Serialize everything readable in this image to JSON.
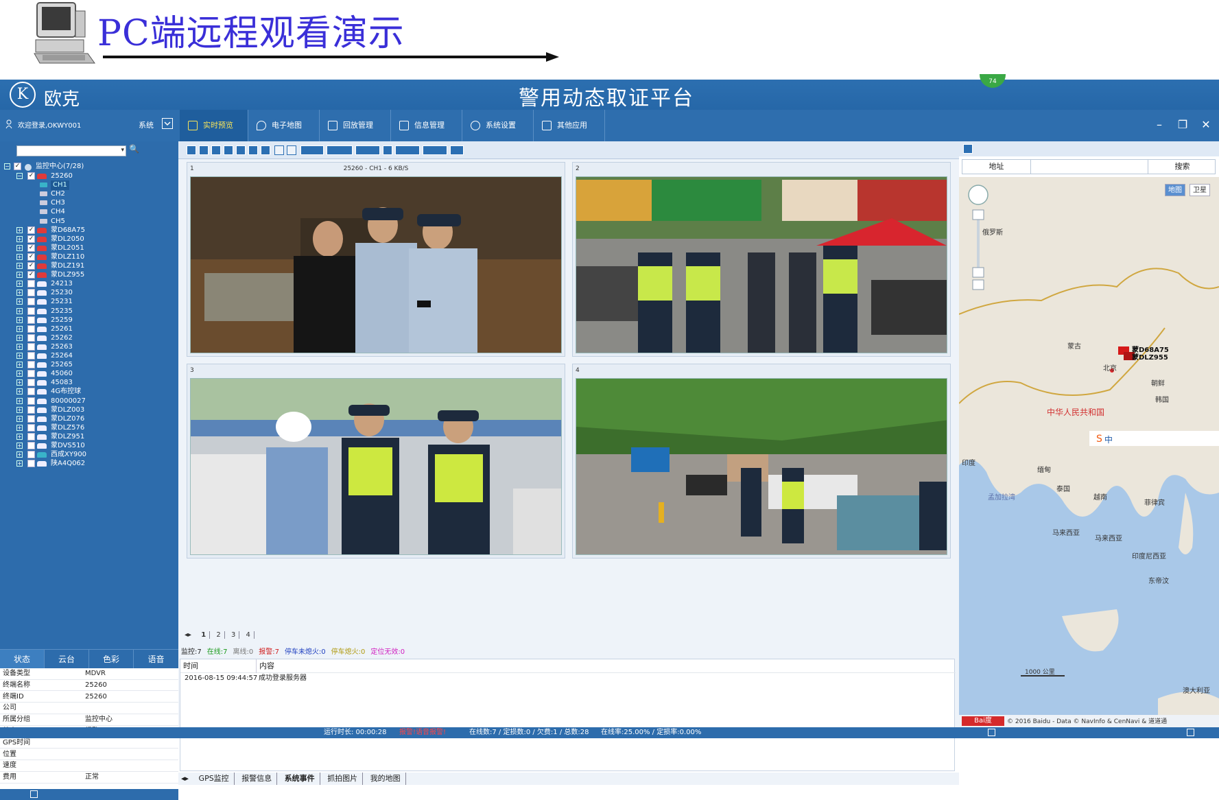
{
  "slide": {
    "title": "PC端远程观看演示"
  },
  "app": {
    "logo_text": "欧克",
    "logo_mark": "K",
    "platform_title": "警用动态取证平台",
    "badge": "74",
    "login_text": "欢迎登录,OKWY001",
    "system_label": "系统",
    "tabs": [
      {
        "label": "实时预览",
        "icon": "monitor-icon"
      },
      {
        "label": "电子地图",
        "icon": "map-pin-icon"
      },
      {
        "label": "回放管理",
        "icon": "video-camera-icon"
      },
      {
        "label": "信息管理",
        "icon": "document-icon"
      },
      {
        "label": "系统设置",
        "icon": "gear-icon"
      },
      {
        "label": "其他应用",
        "icon": "wrench-icon"
      }
    ],
    "window_buttons": {
      "minimize": "–",
      "restore": "❐",
      "close": "✕"
    }
  },
  "tree": {
    "root": "监控中心(7/28)",
    "nodes": [
      {
        "label": "25260",
        "checked": true,
        "alarm": true
      },
      {
        "label": "CH1",
        "channel": true,
        "selected": true
      },
      {
        "label": "CH2",
        "channel": true
      },
      {
        "label": "CH3",
        "channel": true
      },
      {
        "label": "CH4",
        "channel": true
      },
      {
        "label": "CH5",
        "channel": true
      },
      {
        "label": "蒙D68A75",
        "checked": true,
        "alarm": true
      },
      {
        "label": "蒙DL2050",
        "checked": true,
        "alarm": true
      },
      {
        "label": "蒙DL2051",
        "checked": true,
        "alarm": true
      },
      {
        "label": "蒙DLZ110",
        "checked": true,
        "alarm": true
      },
      {
        "label": "蒙DLZ191",
        "checked": true,
        "alarm": true
      },
      {
        "label": "蒙DLZ955",
        "checked": true,
        "alarm": true
      },
      {
        "label": "24213"
      },
      {
        "label": "25230"
      },
      {
        "label": "25231"
      },
      {
        "label": "25235"
      },
      {
        "label": "25259"
      },
      {
        "label": "25261"
      },
      {
        "label": "25262"
      },
      {
        "label": "25263"
      },
      {
        "label": "25264"
      },
      {
        "label": "25265"
      },
      {
        "label": "45060"
      },
      {
        "label": "45083"
      },
      {
        "label": "4G布控球"
      },
      {
        "label": "80000027"
      },
      {
        "label": "蒙DLZ003"
      },
      {
        "label": "蒙DLZ076"
      },
      {
        "label": "蒙DLZ576"
      },
      {
        "label": "蒙DLZ951"
      },
      {
        "label": "蒙DVS510"
      },
      {
        "label": "西成XY900",
        "cyan": true
      },
      {
        "label": "陕A4Q062"
      }
    ]
  },
  "left_tabs": [
    "状态",
    "云台",
    "色彩",
    "语音"
  ],
  "properties": [
    {
      "key": "设备类型",
      "value": "MDVR"
    },
    {
      "key": "终端名称",
      "value": "25260"
    },
    {
      "key": "终端ID",
      "value": "25260"
    },
    {
      "key": "公司",
      "value": ""
    },
    {
      "key": "所属分组",
      "value": "监控中心"
    },
    {
      "key": "状态",
      "value": "报警"
    },
    {
      "key": "GPS时间",
      "value": ""
    },
    {
      "key": "位置",
      "value": ""
    },
    {
      "key": "速度",
      "value": ""
    },
    {
      "key": "费用",
      "value": "正常"
    }
  ],
  "videos": [
    {
      "num": "1",
      "info": "25260 - CH1 - 6 KB/S"
    },
    {
      "num": "2",
      "info": ""
    },
    {
      "num": "3",
      "info": ""
    },
    {
      "num": "4",
      "info": ""
    }
  ],
  "pager": [
    "1",
    "2",
    "3",
    "4"
  ],
  "status_counts": [
    {
      "text": "监控:7",
      "color": "#222222"
    },
    {
      "text": "在线:7",
      "color": "#1a9a1a"
    },
    {
      "text": "离线:0",
      "color": "#777777"
    },
    {
      "text": "报警:7",
      "color": "#d02020"
    },
    {
      "text": "停车未熄火:0",
      "color": "#2040c0"
    },
    {
      "text": "停车熄火:0",
      "color": "#b09a10"
    },
    {
      "text": "定位无效:0",
      "color": "#d020c0"
    }
  ],
  "events": {
    "col_time": "时间",
    "col_content": "内容",
    "rows": [
      {
        "time": "2016-08-15 09:44:57",
        "content": "成功登录服务器"
      }
    ]
  },
  "bottom_tabs": [
    "GPS监控",
    "报警信息",
    "系统事件",
    "抓拍图片",
    "我的地图"
  ],
  "statusbar": {
    "runtime": "运行时长: 00:00:28",
    "alarm": "报警!语音报警!",
    "counts": "在线数:7 / 定损数:0 / 欠费:1 / 总数:28",
    "rates": "在线率:25.00% / 定损率:0.00%"
  },
  "map": {
    "addr_label": "地址",
    "addr_value": "",
    "search_label": "搜索",
    "map_btn": "地图",
    "sat_btn": "卫星",
    "labels": [
      "俄罗斯",
      "蒙古",
      "北京",
      "朝鲜",
      "韩国",
      "中华人民共和国",
      "印度",
      "缅甸",
      "泰国",
      "越南",
      "孟加拉湾",
      "菲律宾",
      "马来西亚",
      "马来西亚",
      "印度尼西亚",
      "东帝汶",
      "澳大利亚"
    ],
    "markers": [
      "蒙D68A75",
      "蒙DLZ955"
    ],
    "scale": "1000 公里",
    "copyright": "© 2016 Baidu - Data © NavInfo & CenNavi & 道道通",
    "ime_bar": "中"
  }
}
